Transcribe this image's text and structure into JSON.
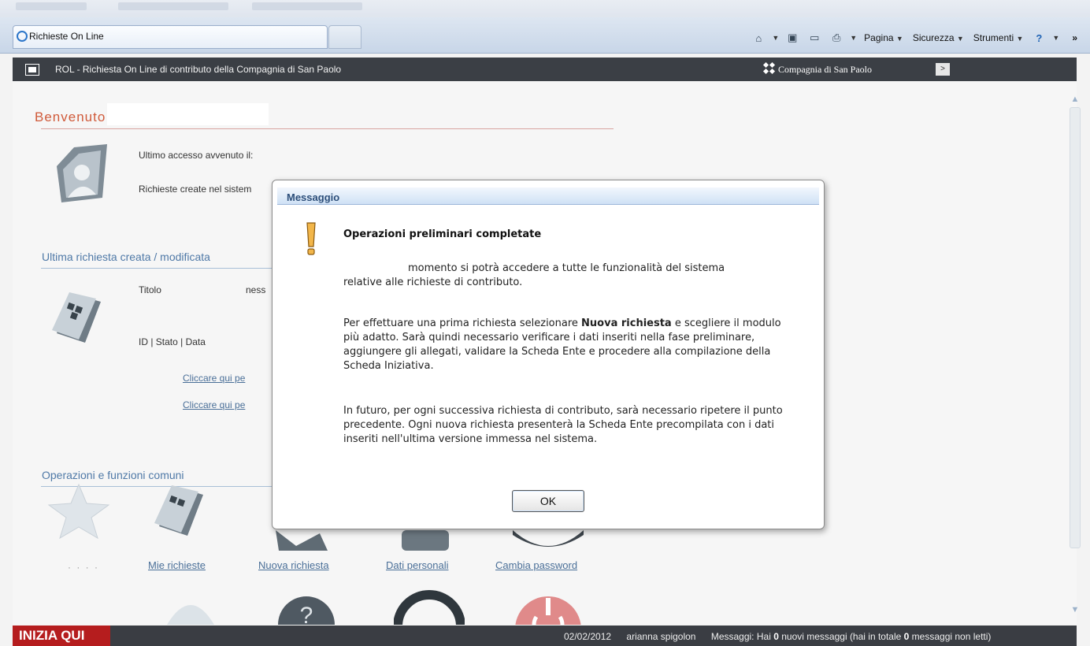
{
  "browser": {
    "tab_title": "Richieste On Line",
    "toolbar": {
      "pagina": "Pagina",
      "sicurezza": "Sicurezza",
      "strumenti": "Strumenti",
      "more": "»"
    }
  },
  "app": {
    "title": "ROL - Richiesta On Line di contributo della Compagnia di San Paolo",
    "brand": "Compagnia di San Paolo",
    "brand_arrow": ">"
  },
  "welcome": {
    "greeting": "Benvenuto a",
    "last_access": "Ultimo accesso avvenuto il:",
    "requests_created": "Richieste create nel sistem"
  },
  "last_request": {
    "section_title": "Ultima richiesta creata / modificata",
    "title_label": "Titolo",
    "title_value": "ness",
    "meta_label": "ID | Stato | Data",
    "link_1": "Cliccare qui pe",
    "link_2": "Cliccare qui pe"
  },
  "operations": {
    "section_title": "Operazioni e funzioni comuni",
    "dots": "· · · ·",
    "items": [
      {
        "label": "Mie richieste"
      },
      {
        "label": "Nuova richiesta"
      },
      {
        "label": "Dati personali"
      },
      {
        "label": "Cambia password"
      }
    ]
  },
  "dialog": {
    "title": "Messaggio",
    "heading": "Operazioni preliminari completate",
    "p1_line1": "momento si potrà accedere a tutte le funzionalità del sistema",
    "p1_line2": "relative alle richieste di contributo.",
    "p2_pre": "Per effettuare una prima richiesta selezionare ",
    "p2_bold": "Nuova richiesta",
    "p2_post": " e scegliere il modulo più adatto. Sarà quindi necessario verificare i dati inseriti nella fase preliminare, aggiungere gli allegati, validare la Scheda Ente e procedere alla compilazione della Scheda Iniziativa.",
    "p3": "In futuro, per ogni successiva richiesta di contributo, sarà necessario ripetere il punto precedente. Ogni nuova richiesta presenterà la Scheda Ente precompilata con i dati inseriti nell'ultima versione immessa nel sistema.",
    "ok_label": "OK"
  },
  "status": {
    "inizia": "INIZIA QUI",
    "date": "02/02/2012",
    "user": "arianna spigolon",
    "msg_pre": "Messaggi: Hai ",
    "new_count": "0",
    "msg_mid": " nuovi messaggi (hai in totale ",
    "total_count": "0",
    "msg_post": " messaggi non letti)"
  },
  "colors": {
    "accent_red": "#b51d1e",
    "app_bar": "#3b3f45",
    "link_blue": "#4a6f98",
    "welcome_orange": "#d05a3a"
  }
}
